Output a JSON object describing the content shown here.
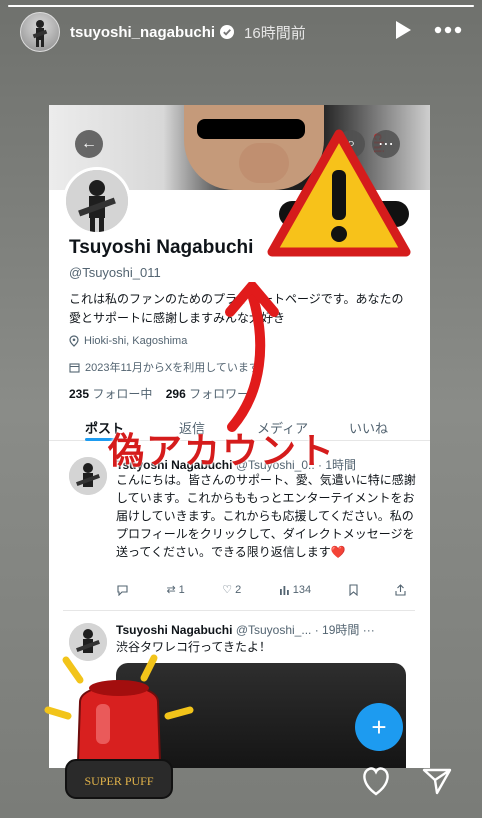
{
  "story": {
    "progress": 1.0,
    "username": "tsuyoshi_nagabuchi",
    "time": "16時間前"
  },
  "profile": {
    "name": "Tsuyoshi Nagabuchi",
    "handle": "@Tsuyoshi_011",
    "bio": "これは私のファンのためのプライベートページです。あなたの愛とサポートに感謝しますみんな大好き",
    "location": "Hioki-shi, Kagoshima",
    "joined": "2023年11月からXを利用しています",
    "following_count": "235",
    "following_label": "フォロー中",
    "followers_count": "296",
    "followers_label": "フォロワー"
  },
  "tabs": [
    "ポスト",
    "返信",
    "メディア",
    "いいね"
  ],
  "tweets": [
    {
      "name": "Tsuyoshi Nagabuchi",
      "handle": "@Tsuyoshi_0..",
      "time": "1時間",
      "body": "こんにちは。皆さんのサポート、愛、気遣いに特に感謝しています。これからももっとエンターテイメントをお届けしていきます。これからも応援してください。私のプロフィールをクリックして、ダイレクトメッセージを送ってください。できる限り返信します❤️",
      "replies": "",
      "reposts": "1",
      "likes": "2",
      "views": "134"
    },
    {
      "name": "Tsuyoshi Nagabuchi",
      "handle": "@Tsuyoshi_...",
      "time": "19時間",
      "body": "渋谷タワレコ行ってきたよ！"
    }
  ],
  "overlay": {
    "fake_label": "偽アカウント",
    "siren_text": "SUPER PUFF"
  },
  "colors": {
    "accent": "#1d9bf0",
    "warning_red": "#d51c1c",
    "warning_yellow": "#f7c21a"
  }
}
